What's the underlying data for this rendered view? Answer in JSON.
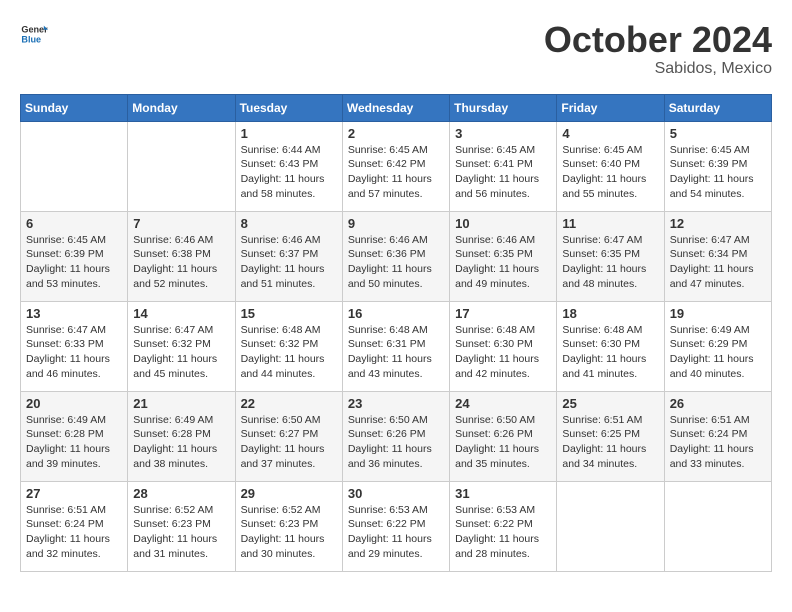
{
  "header": {
    "logo_general": "General",
    "logo_blue": "Blue",
    "month": "October 2024",
    "location": "Sabidos, Mexico"
  },
  "days_of_week": [
    "Sunday",
    "Monday",
    "Tuesday",
    "Wednesday",
    "Thursday",
    "Friday",
    "Saturday"
  ],
  "weeks": [
    [
      {
        "day": "",
        "info": ""
      },
      {
        "day": "",
        "info": ""
      },
      {
        "day": "1",
        "info": "Sunrise: 6:44 AM\nSunset: 6:43 PM\nDaylight: 11 hours and 58 minutes."
      },
      {
        "day": "2",
        "info": "Sunrise: 6:45 AM\nSunset: 6:42 PM\nDaylight: 11 hours and 57 minutes."
      },
      {
        "day": "3",
        "info": "Sunrise: 6:45 AM\nSunset: 6:41 PM\nDaylight: 11 hours and 56 minutes."
      },
      {
        "day": "4",
        "info": "Sunrise: 6:45 AM\nSunset: 6:40 PM\nDaylight: 11 hours and 55 minutes."
      },
      {
        "day": "5",
        "info": "Sunrise: 6:45 AM\nSunset: 6:39 PM\nDaylight: 11 hours and 54 minutes."
      }
    ],
    [
      {
        "day": "6",
        "info": "Sunrise: 6:45 AM\nSunset: 6:39 PM\nDaylight: 11 hours and 53 minutes."
      },
      {
        "day": "7",
        "info": "Sunrise: 6:46 AM\nSunset: 6:38 PM\nDaylight: 11 hours and 52 minutes."
      },
      {
        "day": "8",
        "info": "Sunrise: 6:46 AM\nSunset: 6:37 PM\nDaylight: 11 hours and 51 minutes."
      },
      {
        "day": "9",
        "info": "Sunrise: 6:46 AM\nSunset: 6:36 PM\nDaylight: 11 hours and 50 minutes."
      },
      {
        "day": "10",
        "info": "Sunrise: 6:46 AM\nSunset: 6:35 PM\nDaylight: 11 hours and 49 minutes."
      },
      {
        "day": "11",
        "info": "Sunrise: 6:47 AM\nSunset: 6:35 PM\nDaylight: 11 hours and 48 minutes."
      },
      {
        "day": "12",
        "info": "Sunrise: 6:47 AM\nSunset: 6:34 PM\nDaylight: 11 hours and 47 minutes."
      }
    ],
    [
      {
        "day": "13",
        "info": "Sunrise: 6:47 AM\nSunset: 6:33 PM\nDaylight: 11 hours and 46 minutes."
      },
      {
        "day": "14",
        "info": "Sunrise: 6:47 AM\nSunset: 6:32 PM\nDaylight: 11 hours and 45 minutes."
      },
      {
        "day": "15",
        "info": "Sunrise: 6:48 AM\nSunset: 6:32 PM\nDaylight: 11 hours and 44 minutes."
      },
      {
        "day": "16",
        "info": "Sunrise: 6:48 AM\nSunset: 6:31 PM\nDaylight: 11 hours and 43 minutes."
      },
      {
        "day": "17",
        "info": "Sunrise: 6:48 AM\nSunset: 6:30 PM\nDaylight: 11 hours and 42 minutes."
      },
      {
        "day": "18",
        "info": "Sunrise: 6:48 AM\nSunset: 6:30 PM\nDaylight: 11 hours and 41 minutes."
      },
      {
        "day": "19",
        "info": "Sunrise: 6:49 AM\nSunset: 6:29 PM\nDaylight: 11 hours and 40 minutes."
      }
    ],
    [
      {
        "day": "20",
        "info": "Sunrise: 6:49 AM\nSunset: 6:28 PM\nDaylight: 11 hours and 39 minutes."
      },
      {
        "day": "21",
        "info": "Sunrise: 6:49 AM\nSunset: 6:28 PM\nDaylight: 11 hours and 38 minutes."
      },
      {
        "day": "22",
        "info": "Sunrise: 6:50 AM\nSunset: 6:27 PM\nDaylight: 11 hours and 37 minutes."
      },
      {
        "day": "23",
        "info": "Sunrise: 6:50 AM\nSunset: 6:26 PM\nDaylight: 11 hours and 36 minutes."
      },
      {
        "day": "24",
        "info": "Sunrise: 6:50 AM\nSunset: 6:26 PM\nDaylight: 11 hours and 35 minutes."
      },
      {
        "day": "25",
        "info": "Sunrise: 6:51 AM\nSunset: 6:25 PM\nDaylight: 11 hours and 34 minutes."
      },
      {
        "day": "26",
        "info": "Sunrise: 6:51 AM\nSunset: 6:24 PM\nDaylight: 11 hours and 33 minutes."
      }
    ],
    [
      {
        "day": "27",
        "info": "Sunrise: 6:51 AM\nSunset: 6:24 PM\nDaylight: 11 hours and 32 minutes."
      },
      {
        "day": "28",
        "info": "Sunrise: 6:52 AM\nSunset: 6:23 PM\nDaylight: 11 hours and 31 minutes."
      },
      {
        "day": "29",
        "info": "Sunrise: 6:52 AM\nSunset: 6:23 PM\nDaylight: 11 hours and 30 minutes."
      },
      {
        "day": "30",
        "info": "Sunrise: 6:53 AM\nSunset: 6:22 PM\nDaylight: 11 hours and 29 minutes."
      },
      {
        "day": "31",
        "info": "Sunrise: 6:53 AM\nSunset: 6:22 PM\nDaylight: 11 hours and 28 minutes."
      },
      {
        "day": "",
        "info": ""
      },
      {
        "day": "",
        "info": ""
      }
    ]
  ]
}
